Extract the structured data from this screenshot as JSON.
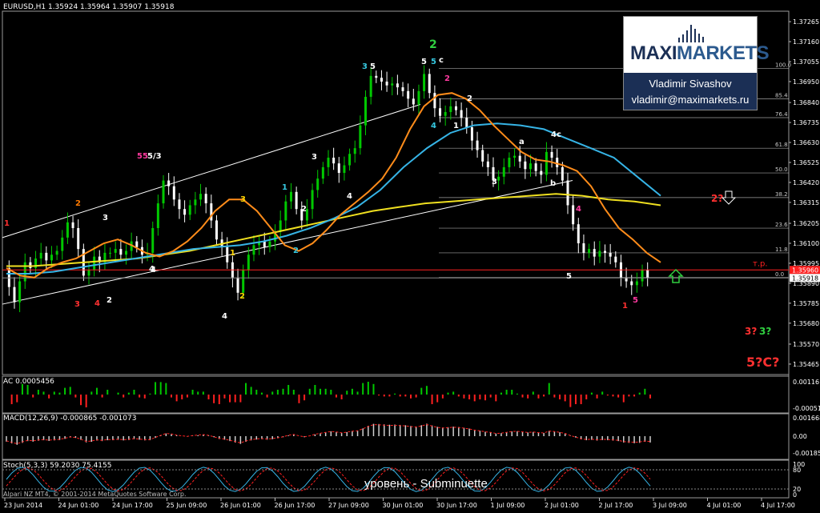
{
  "window": {
    "symbol_header": "EURUSD,H1  1.35924 1.35964 1.35907 1.35918",
    "copyright": "Alpari NZ MT4, © 2001-2014 MetaQuotes Software Corp.",
    "caption": "уровень - Subminuette"
  },
  "branding": {
    "brand_part1": "MAXI",
    "brand_part2": "MARKETS",
    "author_name": "Vladimir Sivashov",
    "author_email": "vladimir@maximarkets.ru"
  },
  "colors": {
    "background": "#000000",
    "bull_candle": "#00c800",
    "bear_candle": "#ffffff",
    "ema_fast": "#ff8c1a",
    "ema_mid": "#36b4e6",
    "ema_slow": "#f0e020",
    "channel": "#ffffff",
    "level_line": "#ff2020",
    "macd_signal": "#ff2020",
    "stoch_main": "#36b4e6",
    "stoch_signal": "#ff2020",
    "fib": "#c8c8c8"
  },
  "chart_data": {
    "type": "candlestick",
    "symbol": "EURUSD",
    "timeframe": "H1",
    "ohlc_last": {
      "open": 1.35924,
      "high": 1.35964,
      "low": 1.35907,
      "close": 1.35918
    },
    "current_price": "1.35918",
    "level_price": "1.35960",
    "level_label": "т.р.",
    "price_ticks": [
      "1.37265",
      "1.37160",
      "1.37055",
      "1.36950",
      "1.36840",
      "1.36735",
      "1.36630",
      "1.36525",
      "1.36420",
      "1.36315",
      "1.36205",
      "1.36100",
      "1.35995",
      "1.35890",
      "1.35785",
      "1.35680",
      "1.35570",
      "1.35465"
    ],
    "ylim": [
      1.3541,
      1.3732
    ],
    "time_labels": [
      "23 Jun 2014",
      "24 Jun 01:00",
      "24 Jun 17:00",
      "25 Jun 09:00",
      "26 Jun 01:00",
      "26 Jun 17:00",
      "27 Jun 09:00",
      "30 Jun 01:00",
      "30 Jun 17:00",
      "1 Jul 09:00",
      "2 Jul 01:00",
      "2 Jul 17:00",
      "3 Jul 09:00",
      "4 Jul 01:00",
      "4 Jul 17:00"
    ],
    "price_path": [
      1.3597,
      1.3587,
      1.3579,
      1.359,
      1.36,
      1.3597,
      1.3602,
      1.3605,
      1.3601,
      1.3604,
      1.3606,
      1.3613,
      1.3621,
      1.3618,
      1.3607,
      1.3593,
      1.3596,
      1.3603,
      1.36,
      1.3605,
      1.3605,
      1.3607,
      1.3604,
      1.3606,
      1.3611,
      1.3608,
      1.3604,
      1.3605,
      1.3618,
      1.3631,
      1.3643,
      1.364,
      1.3633,
      1.3628,
      1.3625,
      1.363,
      1.3633,
      1.3636,
      1.3631,
      1.3622,
      1.3612,
      1.3608,
      1.36,
      1.3592,
      1.3584,
      1.3596,
      1.3604,
      1.3609,
      1.3611,
      1.3608,
      1.3611,
      1.3616,
      1.3622,
      1.3632,
      1.3637,
      1.3628,
      1.3622,
      1.3628,
      1.3638,
      1.3644,
      1.365,
      1.3655,
      1.3652,
      1.3647,
      1.3651,
      1.3657,
      1.366,
      1.3672,
      1.3687,
      1.3698,
      1.3697,
      1.3695,
      1.3693,
      1.3694,
      1.3692,
      1.369,
      1.3686,
      1.3683,
      1.369,
      1.3699,
      1.3689,
      1.3681,
      1.3677,
      1.3679,
      1.3682,
      1.368,
      1.3676,
      1.3671,
      1.3664,
      1.3659,
      1.3653,
      1.365,
      1.3643,
      1.3645,
      1.365,
      1.3655,
      1.3656,
      1.3653,
      1.3649,
      1.3652,
      1.3648,
      1.3646,
      1.3658,
      1.3655,
      1.365,
      1.3643,
      1.363,
      1.362,
      1.361,
      1.3605,
      1.3607,
      1.3603,
      1.3606,
      1.3605,
      1.3603,
      1.36,
      1.3592,
      1.359,
      1.3588,
      1.359,
      1.3596,
      1.3592
    ],
    "ema_fast": [
      1.3597,
      1.3593,
      1.3592,
      1.3597,
      1.36,
      1.3602,
      1.3606,
      1.361,
      1.3612,
      1.3609,
      1.3605,
      1.3603,
      1.3606,
      1.3611,
      1.3618,
      1.3627,
      1.3633,
      1.3633,
      1.3627,
      1.3618,
      1.3609,
      1.3606,
      1.361,
      1.3617,
      1.3625,
      1.3631,
      1.3637,
      1.3644,
      1.3655,
      1.367,
      1.3682,
      1.3688,
      1.3689,
      1.3686,
      1.368,
      1.3672,
      1.3665,
      1.3658,
      1.3654,
      1.3653,
      1.3651,
      1.3648,
      1.364,
      1.3628,
      1.3618,
      1.3612,
      1.3605,
      1.36
    ],
    "ema_mid": [
      1.3594,
      1.3594,
      1.3595,
      1.3597,
      1.3599,
      1.3601,
      1.3603,
      1.3605,
      1.3607,
      1.3608,
      1.3609,
      1.3611,
      1.3614,
      1.3618,
      1.3623,
      1.3629,
      1.3638,
      1.365,
      1.366,
      1.3668,
      1.3672,
      1.3673,
      1.3672,
      1.367,
      1.3665,
      1.366,
      1.3655,
      1.3645,
      1.3635
    ],
    "ema_slow": [
      1.3598,
      1.3598,
      1.3599,
      1.36,
      1.3601,
      1.3602,
      1.3604,
      1.3606,
      1.3609,
      1.3612,
      1.3615,
      1.3618,
      1.3621,
      1.3624,
      1.3627,
      1.3629,
      1.3631,
      1.3632,
      1.3633,
      1.3634,
      1.3635,
      1.3636,
      1.3635,
      1.3633,
      1.3632,
      1.363
    ],
    "fib_levels": [
      "100.0",
      "85.4",
      "76.4",
      "61.8",
      "50.0",
      "38.2",
      "23.6",
      "11.8",
      "0.0"
    ],
    "fib_range": [
      1.3592,
      1.3702
    ],
    "wave_labels": [
      {
        "t": "1",
        "c": "#ff3030"
      },
      {
        "t": "2",
        "c": "#ff7a00"
      },
      {
        "t": "3",
        "c": "#ff3030"
      },
      {
        "t": "4",
        "c": "#ff3030"
      },
      {
        "t": "3",
        "c": "#ffffff"
      },
      {
        "t": "2",
        "c": "#ffffff"
      },
      {
        "t": "4",
        "c": "#ffffff"
      },
      {
        "t": "55",
        "c": "#ff3aa0"
      },
      {
        "t": "5/3",
        "c": "#ffffff"
      },
      {
        "t": "4",
        "c": "#ffffff"
      },
      {
        "t": "1",
        "c": "#ffd400"
      },
      {
        "t": "2",
        "c": "#ffd400"
      },
      {
        "t": "3",
        "c": "#ffd400"
      },
      {
        "t": "4",
        "c": "#ffffff"
      },
      {
        "t": "1",
        "c": "#36c8e0"
      },
      {
        "t": "2",
        "c": "#36c8e0"
      },
      {
        "t": "2",
        "c": "#ffffff"
      },
      {
        "t": "3",
        "c": "#ffffff"
      },
      {
        "t": "4",
        "c": "#ffffff"
      },
      {
        "t": "3",
        "c": "#36c8e0"
      },
      {
        "t": "5",
        "c": "#ffffff"
      },
      {
        "t": "2",
        "c": "#30d040"
      },
      {
        "t": "5",
        "c": "#ffffff"
      },
      {
        "t": "5",
        "c": "#36c8e0"
      },
      {
        "t": "c",
        "c": "#ffffff"
      },
      {
        "t": "2",
        "c": "#ff3aa0"
      },
      {
        "t": "4",
        "c": "#36c8e0"
      },
      {
        "t": "1",
        "c": "#ffffff"
      },
      {
        "t": "2",
        "c": "#ffffff"
      },
      {
        "t": "3",
        "c": "#ffffff"
      },
      {
        "t": "a",
        "c": "#ffffff"
      },
      {
        "t": "b",
        "c": "#ffffff"
      },
      {
        "t": "4c",
        "c": "#ffffff"
      },
      {
        "t": "4",
        "c": "#ff3aa0"
      },
      {
        "t": "5",
        "c": "#ffffff"
      },
      {
        "t": "1",
        "c": "#ff3030"
      },
      {
        "t": "5",
        "c": "#ff3aa0"
      }
    ],
    "forecast_labels": [
      {
        "t": "2?",
        "c": "#ff3030"
      },
      {
        "t": "3?",
        "c": "#ff3030"
      },
      {
        "t": "3?",
        "c": "#30d040"
      },
      {
        "t": "5?C?",
        "c": "#ff3030"
      }
    ],
    "indicators": [
      {
        "name": "AC 0.0005456",
        "ticks": [
          "0.00116",
          "-0.00051"
        ]
      },
      {
        "name": "MACD(12,26,9) -0.000865 -0.001073",
        "ticks": [
          "0.001668",
          "0.00",
          "-0.00185"
        ]
      },
      {
        "name": "Stoch(5,3,3) 59.2030 75.4155",
        "ticks": [
          "100",
          "80",
          "20",
          "0"
        ]
      }
    ]
  }
}
